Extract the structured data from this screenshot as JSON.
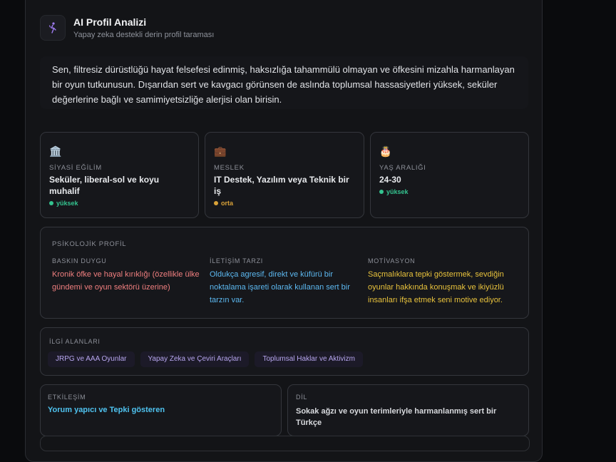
{
  "header": {
    "title": "AI Profil Analizi",
    "subtitle": "Yapay zeka destekli derin profil taraması",
    "icon": "sparkle-person-icon",
    "icon_color": "#9f7cf2"
  },
  "summary": "Sen, filtresiz dürüstlüğü hayat felsefesi edinmiş, haksızlığa tahammülü olmayan ve öfkesini mizahla harmanlayan bir oyun tutkunusun. Dışarıdan sert ve kavgacı görünsen de aslında toplumsal hassasiyetleri yüksek, seküler değerlerine bağlı ve samimiyetsizliğe alerjisi olan birisin.",
  "stats": [
    {
      "icon": "🏛️",
      "icon_name": "government-building-icon",
      "label": "SİYASİ EĞİLİM",
      "value": "Seküler, liberal-sol ve koyu muhalif",
      "confidence": "yüksek",
      "confidence_color": "#34c38f"
    },
    {
      "icon": "💼",
      "icon_name": "briefcase-icon",
      "label": "MESLEK",
      "value": "IT Destek, Yazılım veya Teknik bir iş",
      "confidence": "orta",
      "confidence_color": "#d9a238"
    },
    {
      "icon": "🎂",
      "icon_name": "birthday-cake-icon",
      "label": "YAŞ ARALIĞI",
      "value": "24-30",
      "confidence": "yüksek",
      "confidence_color": "#34c38f"
    }
  ],
  "psychology": {
    "title": "PSİKOLOJİK PROFİL",
    "columns": [
      {
        "label": "BASKIN DUYGU",
        "text": "Kronik öfke ve hayal kırıklığı (özellikle ülke gündemi ve oyun sektörü üzerine)",
        "color": "#f07f7f"
      },
      {
        "label": "İLETİŞİM TARZI",
        "text": "Oldukça agresif, direkt ve küfürü bir noktalama işareti olarak kullanan sert bir tarzın var.",
        "color": "#5cb8f0"
      },
      {
        "label": "MOTİVASYON",
        "text": "Saçmalıklara tepki göstermek, sevdiğin oyunlar hakkında konuşmak ve ikiyüzlü insanları ifşa etmek seni motive ediyor.",
        "color": "#e8c23c"
      }
    ]
  },
  "interests": {
    "label": "İLGİ ALANLARI",
    "tags": [
      "JRPG ve AAA Oyunlar",
      "Yapay Zeka ve Çeviri Araçları",
      "Toplumsal Haklar ve Aktivizm"
    ]
  },
  "engagement": {
    "label": "ETKİLEŞİM",
    "value": "Yorum yapıcı ve Tepki gösteren",
    "color": "#4fc3f0"
  },
  "language": {
    "label": "DİL",
    "value": "Sokak ağzı ve oyun terimleriyle harmanlanmış sert bir Türkçe"
  }
}
